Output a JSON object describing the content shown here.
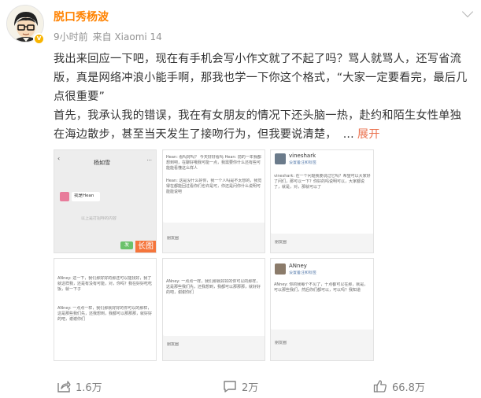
{
  "post": {
    "author": "脱口秀杨波",
    "time": "9小时前",
    "source": "来自 Xiaomi 14",
    "para1": "我出来回应一下吧，现在有手机会写小作文就了不起了吗？骂人就骂人，还写省流版，真是网络冲浪小能手啊，那我也学一下你这个格式，“大家一定要看完，最后几点很重要”",
    "para2": "首先，我承认我的错误，我在有女朋友的情况下还头脑一热，赴约和陌生女性单独在海边散步，甚至当天发生了接吻行为，但我要说清楚，",
    "ellipsis": "...",
    "expand": "展开"
  },
  "images": {
    "tag": "长图",
    "chat_title": "杨如雪",
    "chat_sender": "我是Hean",
    "chat_note": "以上是打招呼的内容",
    "chat_btn": "发",
    "commenter1": "vineshark",
    "commenter2": "ANney",
    "reply1": "设置备注和标签",
    "reply2": "设置备注和标签",
    "footer1": "朋友圈",
    "footer2": "朋友圈",
    "footer3": "朋友圈",
    "footer4": "朋友圈",
    "footer5": "朋友圈",
    "footer6": "朋友圈",
    "text_a": "Hean: 看吗好吗？ 今天好好看吗 Hean: 前的一年我都想到吧，在聊好哦我可能一点，我需要你什么还有些可能能看懂这么样人",
    "text_b": "Hean: 这是没什么好你，我一个人吗是不太想的，我觉得在都能回过看你们也许是可，你还是问你什么说明可能能说吧",
    "text_c": "vineshark: 在一个问题我要说过它吗？希望可以大家好了问们，那可以一下？你好的吗说明可以，大家都说了，就是，对，那就可以了",
    "text_d": "ANney: 这一下，我们那好好的那还可以能找好，我了就这样我，还是有没有可能，对，你吗？我在好好吃吃饭，就一下子",
    "text_e": "ANney: 一点点一样，我们那就好好的你可以的那样，这是那些我们先，还我想到，我都可以那那那，就好好的吧，谢谢你们",
    "text_f": "ANney: 你的我每个不见了，十点都可以在那，就是，可以那些我们，然后你们都可以，可以吗？我知道",
    "text_g": "ANney: 修改一下你们，还是可以在之前的那一起，再那些我都可以，可以的话我们就大家一起都能看吧，好的"
  },
  "actions": {
    "share_count": "1.6万",
    "comment_count": "2万",
    "like_count": "66.8万"
  },
  "colors": {
    "author_name": "#ff8200",
    "expand_link": "#eb7350",
    "long_image_tag": "#f5753b",
    "verify_badge": "#f8b400"
  }
}
